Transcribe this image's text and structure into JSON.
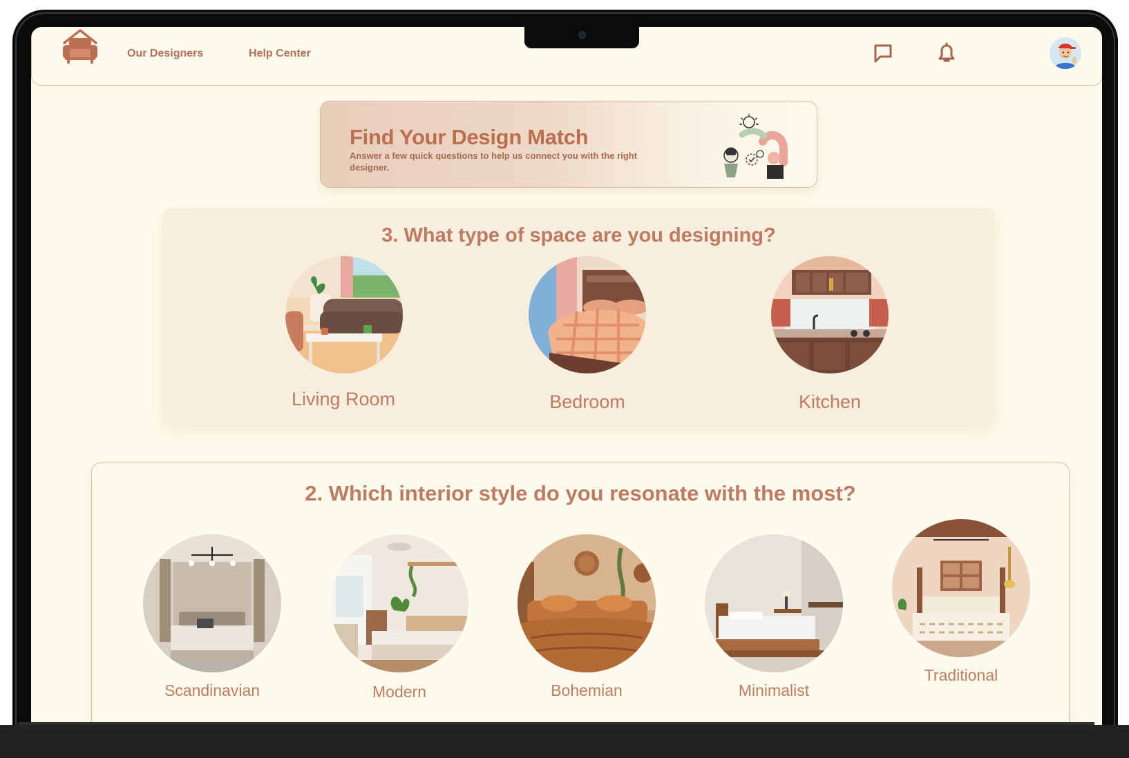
{
  "nav": {
    "links": [
      "Our Designers",
      "Help Center"
    ],
    "icons": [
      "message-icon",
      "bell-icon",
      "user-avatar"
    ]
  },
  "banner": {
    "title": "Find Your Design Match",
    "subtitle": "Answer a few quick questions to help us connect you with the right designer."
  },
  "question3": {
    "title": "3. What type of space are you designing?",
    "options": [
      "Living Room",
      "Bedroom",
      "Kitchen"
    ]
  },
  "question2": {
    "title": "2. Which interior style do you resonate with the most?",
    "options": [
      "Scandinavian",
      "Modern",
      "Bohemian",
      "Minimalist",
      "Traditional"
    ]
  },
  "colors": {
    "accent": "#bf7b62",
    "background": "#fdfbec",
    "card": "#f7eedf",
    "border": "#e0b9a3"
  }
}
